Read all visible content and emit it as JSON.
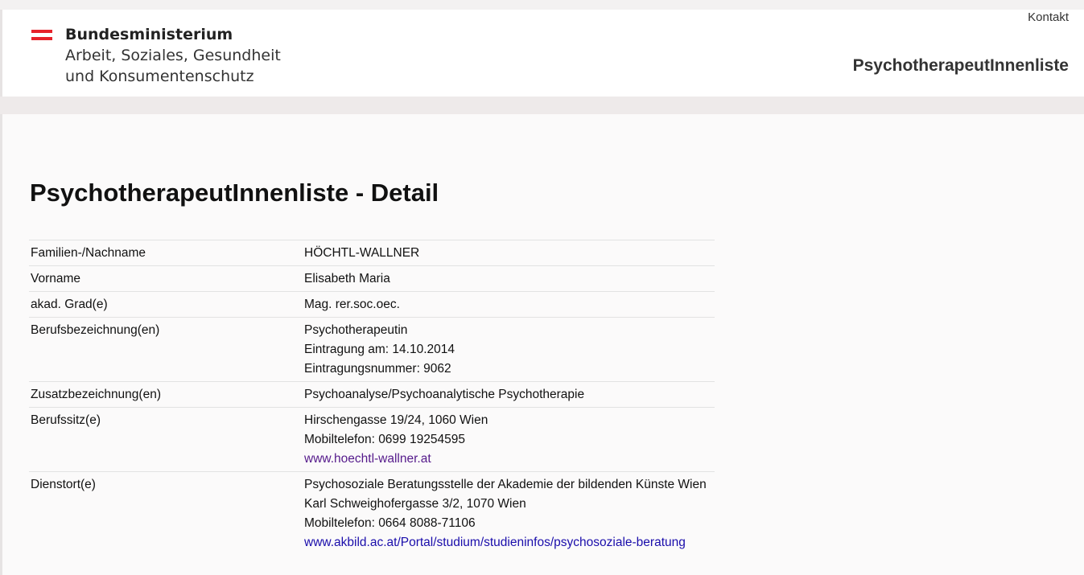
{
  "header": {
    "ministry": {
      "line1": "Bundesministerium",
      "line2": "Arbeit, Soziales, Gesundheit",
      "line3": "und Konsumentenschutz"
    },
    "contact_link": "Kontakt",
    "site_title": "PsychotherapeutInnenliste"
  },
  "page": {
    "title": "PsychotherapeutInnenliste - Detail"
  },
  "detail": {
    "surname": {
      "label": "Familien-/Nachname",
      "value": "HÖCHTL-WALLNER"
    },
    "firstname": {
      "label": "Vorname",
      "value": "Elisabeth Maria"
    },
    "degree": {
      "label": "akad. Grad(e)",
      "value": "Mag. rer.soc.oec."
    },
    "profession": {
      "label": "Berufsbezeichnung(en)",
      "title": "Psychotherapeutin",
      "entry_date": "Eintragung am: 14.10.2014",
      "entry_number": "Eintragungsnummer: 9062"
    },
    "additional": {
      "label": "Zusatzbezeichnung(en)",
      "value": "Psychoanalyse/Psychoanalytische Psychotherapie"
    },
    "practice": {
      "label": "Berufssitz(e)",
      "address": "Hirschengasse 19/24, 1060 Wien",
      "phone": "Mobiltelefon: 0699 19254595",
      "website": "www.hoechtl-wallner.at"
    },
    "workplace": {
      "label": "Dienstort(e)",
      "name": "Psychosoziale Beratungsstelle der Akademie der bildenden Künste Wien",
      "address": "Karl Schweighofergasse 3/2, 1070 Wien",
      "phone": "Mobiltelefon: 0664 8088-71106",
      "website": "www.akbild.ac.at/Portal/studium/studieninfos/psychosoziale-beratung"
    }
  },
  "colors": {
    "flag_red": "#e6232b",
    "visited_link": "#551a8b",
    "link": "#1a0dab"
  }
}
